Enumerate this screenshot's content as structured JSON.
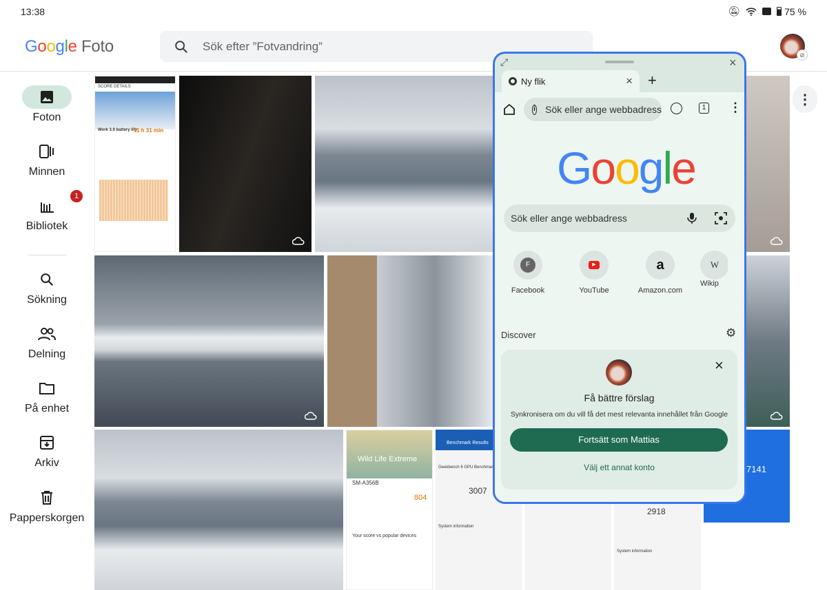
{
  "status_bar": {
    "time": "13:38",
    "battery": "75 %",
    "icons": [
      "mute-icon",
      "wifi-icon",
      "notification-icon",
      "battery-icon"
    ]
  },
  "header": {
    "logo_google": "Google",
    "logo_product": "Foto",
    "search_placeholder": "Sök efter ”Fotvandring”"
  },
  "sidebar": {
    "items": [
      {
        "label": "Foton",
        "icon": "photo-icon",
        "active": true
      },
      {
        "label": "Minnen",
        "icon": "memories-icon"
      },
      {
        "label": "Bibliotek",
        "icon": "library-icon",
        "badge": "1"
      },
      {
        "label": "Sökning",
        "icon": "search-icon"
      },
      {
        "label": "Delning",
        "icon": "people-icon"
      },
      {
        "label": "På enhet",
        "icon": "folder-icon"
      },
      {
        "label": "Arkiv",
        "icon": "archive-icon"
      },
      {
        "label": "Papperskorgen",
        "icon": "trash-icon"
      }
    ]
  },
  "thumbnails": {
    "battery_screenshot": {
      "title": "SCORE DETAILS",
      "label": "Work 3.0 battery life",
      "value": "11 h 31 min"
    },
    "wildlife": {
      "title": "Wild Life Extreme",
      "device": "SM-A356B",
      "score": "804",
      "popular": "Your score vs popular devices"
    },
    "geekbench_gpu": {
      "title": "Benchmark Results",
      "subtitle": "Geekbench 6 GPU Benchmark",
      "score": "3007",
      "section": "System information"
    },
    "geekbench_cpu": {
      "score": "2918",
      "section": "System information"
    },
    "antutu": {
      "score": "7141"
    }
  },
  "chrome": {
    "tab_title": "Ny flik",
    "omnibox_placeholder": "Sök eller ange webbadress",
    "tab_count": "1",
    "search_placeholder": "Sök eller ange webbadress",
    "shortcuts": [
      {
        "label": "Facebook",
        "letter": "F"
      },
      {
        "label": "YouTube"
      },
      {
        "label": "Amazon.com",
        "letter": "a"
      },
      {
        "label": "Wikip",
        "letter": "W"
      }
    ],
    "discover_label": "Discover",
    "sync_card": {
      "title": "Få bättre förslag",
      "body": "Synkronisera om du vill få det mest relevanta innehållet från Google",
      "primary": "Fortsätt som Mattias",
      "secondary": "Välj ett annat konto"
    },
    "colors": {
      "border": "#3a76e8",
      "primary_button": "#1e6b52"
    }
  }
}
